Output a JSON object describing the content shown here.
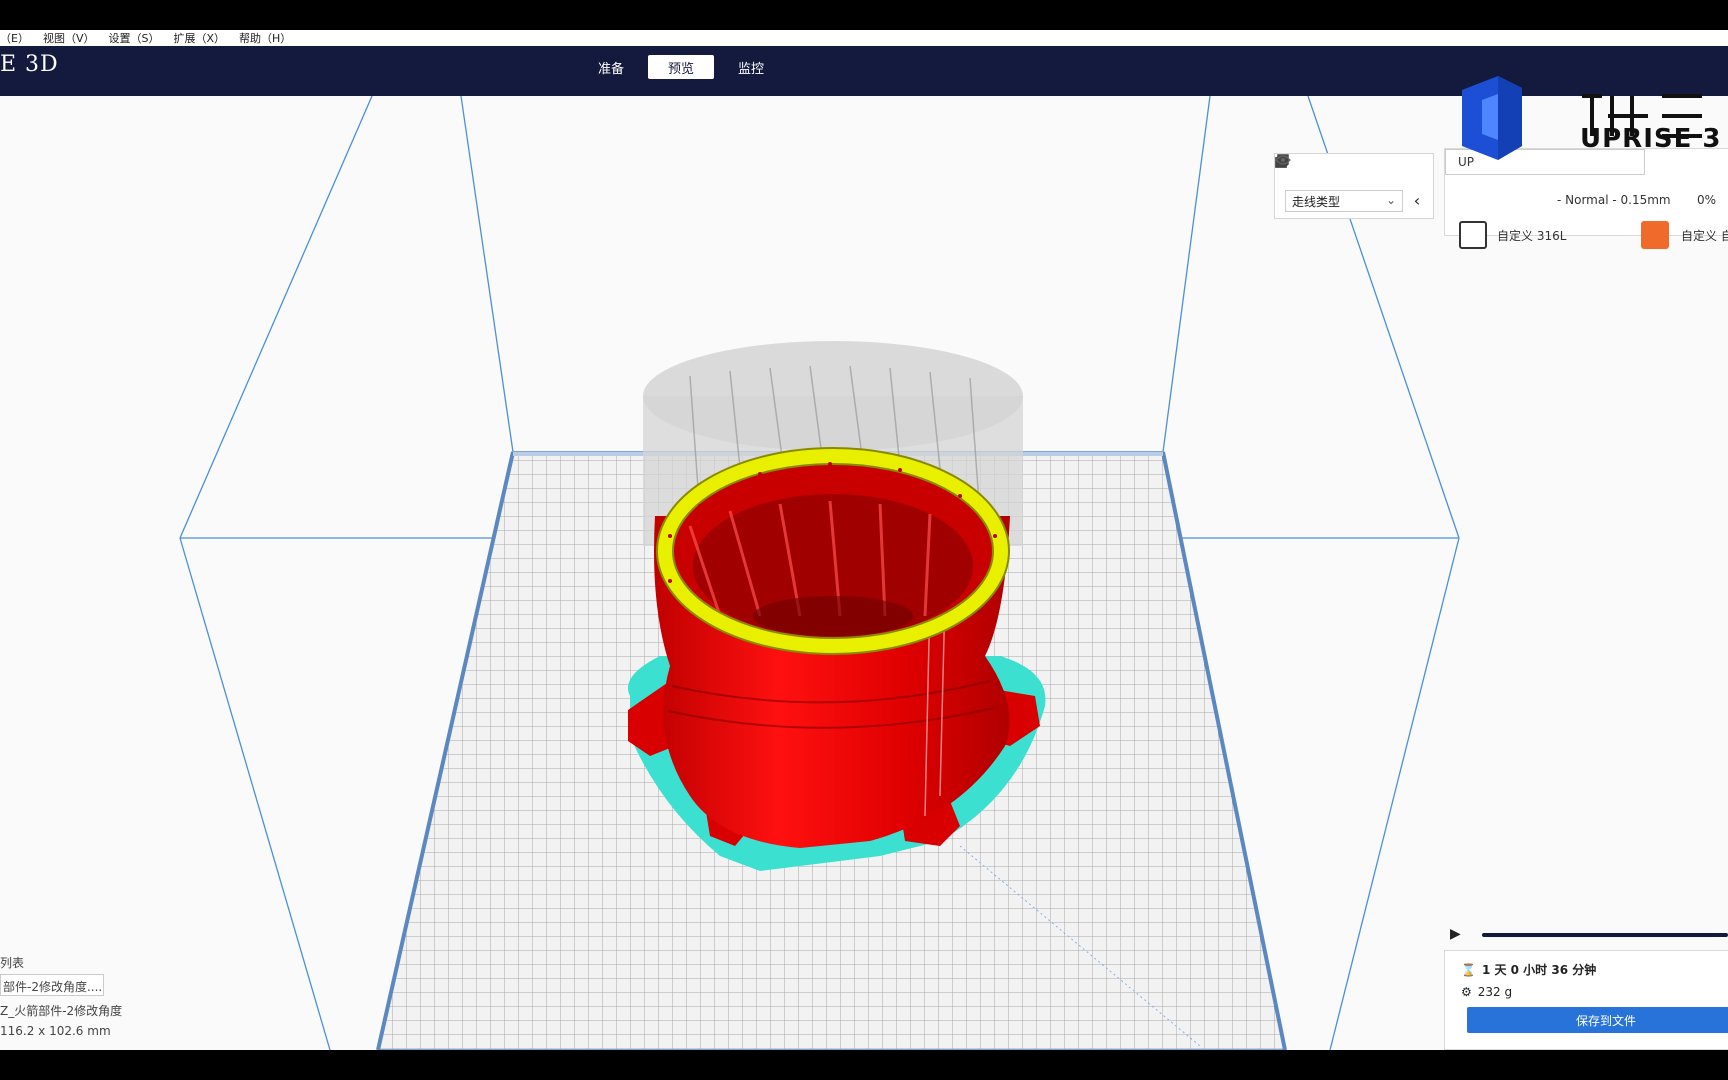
{
  "menu": [
    "（E）",
    "视图（V）",
    "设置（S）",
    "扩展（X）",
    "帮助（H）"
  ],
  "app": {
    "brand": "E 3D"
  },
  "stages": [
    {
      "label": "准备",
      "active": false
    },
    {
      "label": "预览",
      "active": true
    },
    {
      "label": "监控",
      "active": false
    }
  ],
  "view_panel": {
    "color_scheme": "走线类型"
  },
  "print_setup": {
    "printer": "UP",
    "profile": "- Normal - 0.15mm",
    "infill": "0%",
    "material_left": "自定义 316L",
    "material_right": "自定义 自"
  },
  "logo": {
    "text": "UPRISE 3"
  },
  "object_list": {
    "title": "列表",
    "selected": "部件-2修改角度....",
    "name": "Z_火箭部件-2修改角度",
    "dimensions": "116.2 x 102.6 mm"
  },
  "estimate": {
    "time": "1 天 0 小时 36 分钟",
    "weight": "232 g",
    "save_label": "保存到文件"
  },
  "colors": {
    "topbar": "#141a3e",
    "model": "#e50000",
    "infill_top": "#e8f000",
    "skirt": "#3ce0d0",
    "accent": "#2773d9"
  }
}
